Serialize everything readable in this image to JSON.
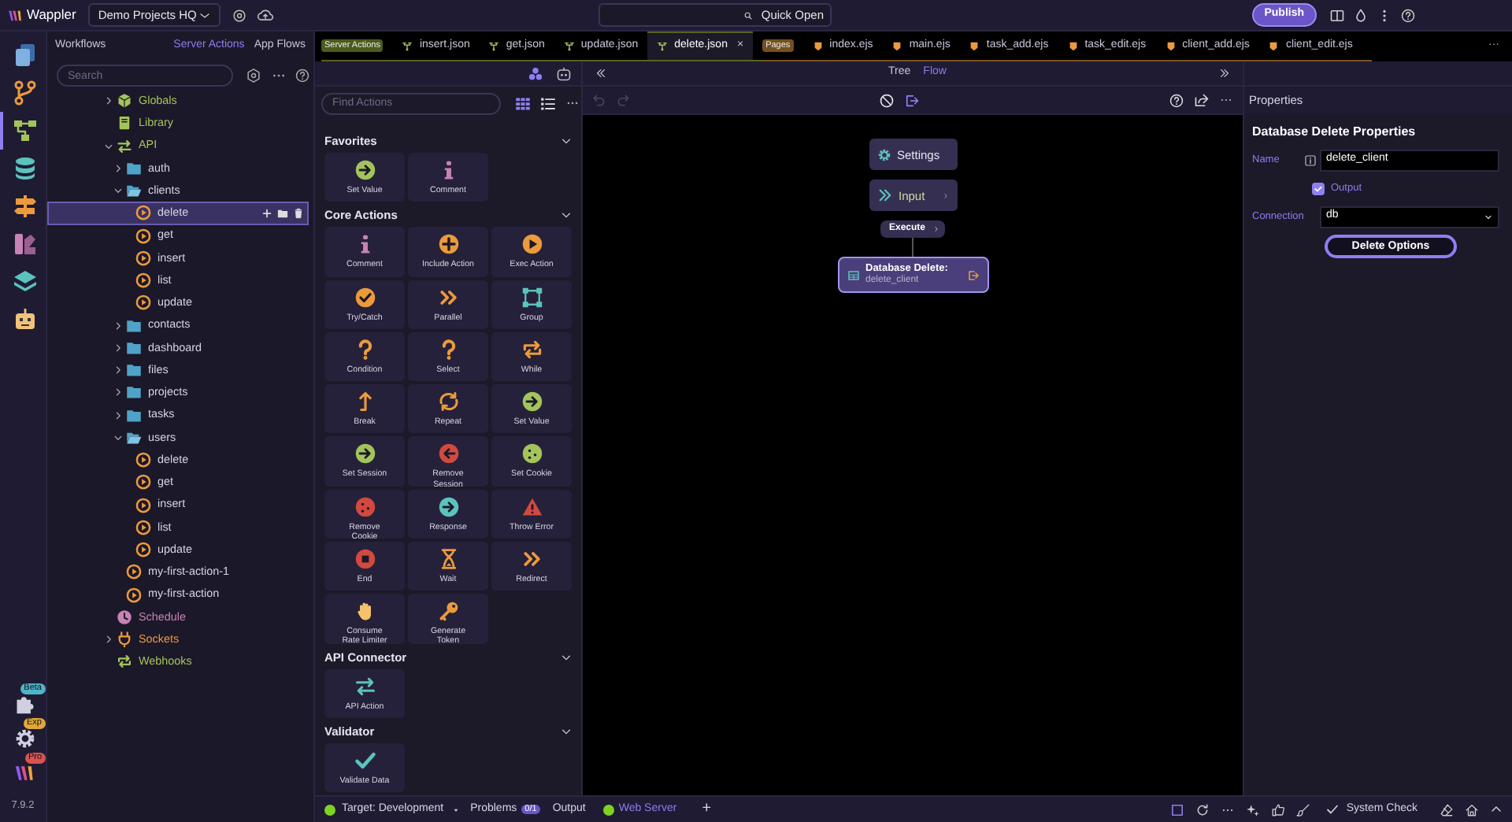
{
  "topbar": {
    "logo": "Wappler",
    "project": "Demo Projects HQ",
    "quick_open": {
      "placeholder": "Quick Open"
    },
    "publish": "Publish"
  },
  "rail": {
    "items": [
      {
        "kind": "files",
        "selected": false
      },
      {
        "kind": "branch",
        "selected": false
      },
      {
        "kind": "flow",
        "selected": true
      },
      {
        "kind": "database",
        "selected": false
      },
      {
        "kind": "signpost",
        "selected": false
      },
      {
        "kind": "palette",
        "selected": false
      },
      {
        "kind": "layers",
        "selected": false
      },
      {
        "kind": "robot",
        "selected": false
      }
    ],
    "extras": [
      {
        "kind": "puzzle",
        "badge": "Beta",
        "color": "#4fb3c8"
      },
      {
        "kind": "gear",
        "badge": "Exp",
        "color": "#e0a838"
      },
      {
        "kind": "logo",
        "badge": "Pro",
        "color": "#d9534f"
      }
    ],
    "version": "7.9.2"
  },
  "workflows": {
    "title": "Workflows",
    "tabs": [
      {
        "label": "Server Actions",
        "selected": true
      },
      {
        "label": "App Flows",
        "selected": false
      }
    ],
    "search": {
      "placeholder": "Search"
    },
    "tree": [
      {
        "kind": "globals",
        "label": "Globals",
        "expanded": false
      },
      {
        "kind": "library",
        "label": "Library"
      },
      {
        "kind": "api",
        "label": "API",
        "expanded": true,
        "children": [
          {
            "kind": "folder",
            "label": "auth",
            "expanded": false
          },
          {
            "kind": "folder",
            "label": "clients",
            "expanded": true,
            "children": [
              {
                "kind": "action",
                "label": "delete",
                "selected": true
              },
              {
                "kind": "action",
                "label": "get",
                "selected": false
              },
              {
                "kind": "action",
                "label": "insert",
                "selected": false
              },
              {
                "kind": "action",
                "label": "list",
                "selected": false
              },
              {
                "kind": "action",
                "label": "update",
                "selected": false
              }
            ]
          },
          {
            "kind": "folder",
            "label": "contacts",
            "expanded": false
          },
          {
            "kind": "folder",
            "label": "dashboard",
            "expanded": false
          },
          {
            "kind": "folder",
            "label": "files",
            "expanded": false
          },
          {
            "kind": "folder",
            "label": "projects",
            "expanded": false
          },
          {
            "kind": "folder",
            "label": "tasks",
            "expanded": false
          },
          {
            "kind": "folder",
            "label": "users",
            "expanded": true,
            "children": [
              {
                "kind": "action",
                "label": "delete",
                "selected": false
              },
              {
                "kind": "action",
                "label": "get",
                "selected": false
              },
              {
                "kind": "action",
                "label": "insert",
                "selected": false
              },
              {
                "kind": "action",
                "label": "list",
                "selected": false
              },
              {
                "kind": "action",
                "label": "update",
                "selected": false
              }
            ]
          },
          {
            "kind": "action",
            "label": "my-first-action-1",
            "selected": false
          },
          {
            "kind": "action",
            "label": "my-first-action",
            "selected": false
          }
        ]
      },
      {
        "kind": "schedule",
        "label": "Schedule"
      },
      {
        "kind": "sockets",
        "label": "Sockets",
        "expanded": false
      },
      {
        "kind": "webhooks",
        "label": "Webhooks"
      }
    ]
  },
  "editor_tabs": {
    "groups": [
      {
        "kind": "server",
        "badge": "Server Actions",
        "tabs": [
          {
            "label": "insert.json",
            "selected": false
          },
          {
            "label": "get.json",
            "selected": false
          },
          {
            "label": "update.json",
            "selected": false
          },
          {
            "label": "delete.json",
            "selected": true,
            "close": "×"
          }
        ]
      },
      {
        "kind": "pages",
        "badge": "Pages",
        "tabs": [
          {
            "label": "index.ejs",
            "selected": false
          },
          {
            "label": "main.ejs",
            "selected": false
          },
          {
            "label": "task_add.ejs",
            "selected": false
          },
          {
            "label": "task_edit.ejs",
            "selected": false
          },
          {
            "label": "client_add.ejs",
            "selected": false
          },
          {
            "label": "client_edit.ejs",
            "selected": false
          }
        ]
      }
    ],
    "more": "···"
  },
  "actions": {
    "search": {
      "placeholder": "Find Actions"
    },
    "views": [
      {
        "kind": "grid",
        "selected": true
      },
      {
        "kind": "list",
        "selected": false
      }
    ],
    "sections": [
      {
        "title": "Favorites",
        "expanded": true,
        "items": [
          {
            "label": "Set Value",
            "kind": "next",
            "color": "#a3c45a"
          },
          {
            "label": "Comment",
            "kind": "info",
            "color": "#c783b6"
          }
        ]
      },
      {
        "title": "Core Actions",
        "expanded": true,
        "items": [
          {
            "label": "Comment",
            "kind": "info",
            "color": "#c783b6"
          },
          {
            "label": "Include Action",
            "kind": "plus",
            "color": "#eb9a3c"
          },
          {
            "label": "Exec Action",
            "kind": "play",
            "color": "#eb9a3c"
          },
          {
            "label": "Try/Catch",
            "kind": "check",
            "color": "#eb9a3c"
          },
          {
            "label": "Parallel",
            "kind": "chevrons",
            "color": "#eb9a3c"
          },
          {
            "label": "Group",
            "kind": "frame",
            "color": "#5cc2bd"
          },
          {
            "label": "Condition",
            "kind": "question",
            "color": "#eb9a3c"
          },
          {
            "label": "Select",
            "kind": "question",
            "color": "#eb9a3c"
          },
          {
            "label": "While",
            "kind": "loop",
            "color": "#eb9a3c"
          },
          {
            "label": "Break",
            "kind": "up",
            "color": "#eb9a3c"
          },
          {
            "label": "Repeat",
            "kind": "repeat",
            "color": "#eb9a3c"
          },
          {
            "label": "Set Value",
            "kind": "next",
            "color": "#a3c45a"
          },
          {
            "label": "Set Session",
            "kind": "next",
            "color": "#a3c45a"
          },
          {
            "label": "Remove Session",
            "kind": "back",
            "color": "#d2493f"
          },
          {
            "label": "Set Cookie",
            "kind": "cookie",
            "color": "#a3c45a"
          },
          {
            "label": "Remove Cookie",
            "kind": "cookie",
            "color": "#d2493f"
          },
          {
            "label": "Response",
            "kind": "next",
            "color": "#5cc2bd"
          },
          {
            "label": "Throw Error",
            "kind": "alert",
            "color": "#d2493f"
          },
          {
            "label": "End",
            "kind": "stop",
            "color": "#d2493f"
          },
          {
            "label": "Wait",
            "kind": "hourglass",
            "color": "#eb9a3c"
          },
          {
            "label": "Redirect",
            "kind": "chevrons",
            "color": "#eb9a3c"
          },
          {
            "label": "Consume Rate Limiter",
            "kind": "hand",
            "color": "#f5c26b"
          },
          {
            "label": "Generate Token",
            "kind": "key",
            "color": "#eb9a3c"
          }
        ]
      },
      {
        "title": "API Connector",
        "expanded": true,
        "items": [
          {
            "label": "API Action",
            "kind": "swap",
            "color": "#5cc2bd"
          }
        ]
      },
      {
        "title": "Validator",
        "expanded": true,
        "items": [
          {
            "label": "Validate Data",
            "kind": "tick",
            "color": "#5cc2bd"
          }
        ]
      }
    ]
  },
  "flow": {
    "views": [
      {
        "label": "Tree",
        "selected": false
      },
      {
        "label": "Flow",
        "selected": true
      }
    ],
    "nodes": [
      {
        "kind": "settings",
        "label": "Settings"
      },
      {
        "kind": "input",
        "label": "Input"
      },
      {
        "kind": "step",
        "label": "Execute"
      },
      {
        "kind": "action",
        "label": "Database Delete:",
        "sublabel": "delete_client",
        "selected": true
      }
    ]
  },
  "properties": {
    "title": "Properties",
    "heading": "Database Delete Properties",
    "fields": [
      {
        "kind": "text",
        "label": "Name",
        "value": "delete_client"
      },
      {
        "kind": "checkbox",
        "label": "Output",
        "checked": true
      },
      {
        "kind": "select",
        "label": "Connection",
        "value": "db"
      },
      {
        "kind": "button",
        "label": "Delete Options"
      }
    ]
  },
  "status_bar": {
    "target": "Target: Development",
    "problems": "Problems",
    "problems_count": "0/1",
    "output": "Output",
    "web_server": "Web Server",
    "add": "+",
    "system_check": "System Check"
  }
}
